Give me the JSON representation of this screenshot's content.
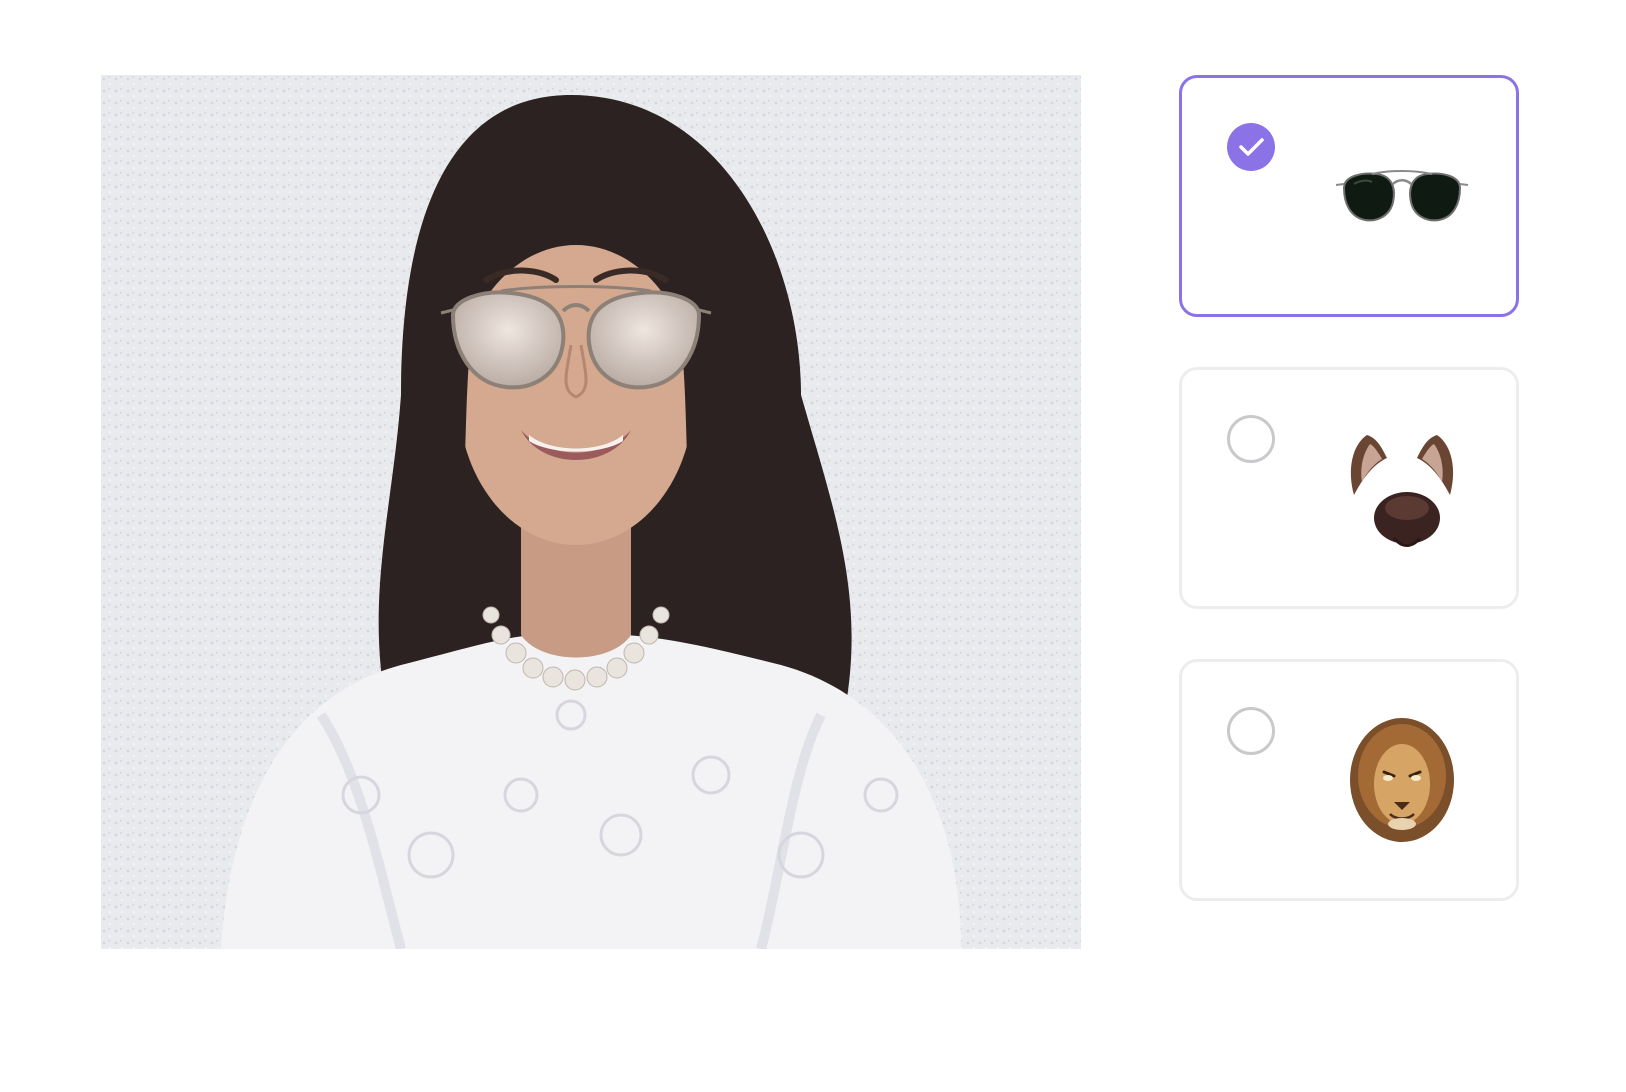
{
  "preview": {
    "image": "portrait-with-sunglasses-filter",
    "active_filter": "aviator-sunglasses"
  },
  "filters": [
    {
      "id": "aviator-sunglasses",
      "icon": "sunglasses-icon",
      "selected": true
    },
    {
      "id": "dog-ears-nose",
      "icon": "dog-ears-icon",
      "selected": false
    },
    {
      "id": "lion-mask",
      "icon": "lion-icon",
      "selected": false
    }
  ],
  "colors": {
    "accent": "#8b72e6",
    "card_border": "#ededf0",
    "radio_border": "#c9c9cc"
  }
}
